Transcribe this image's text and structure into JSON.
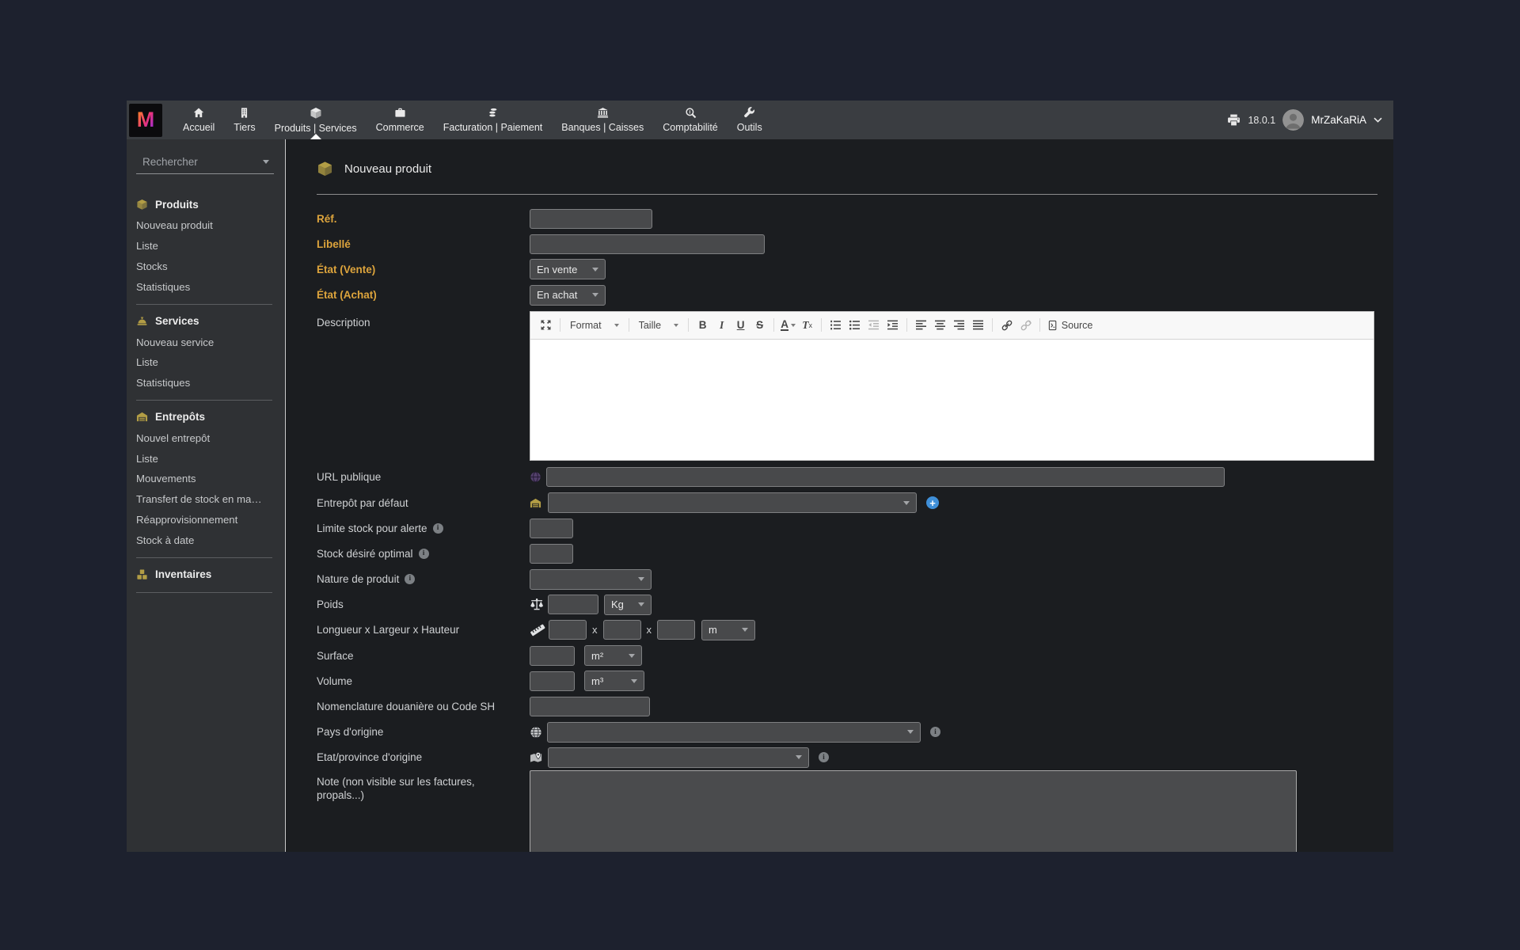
{
  "topbar": {
    "logo_text": "M",
    "menu": {
      "accueil": "Accueil",
      "tiers": "Tiers",
      "produits_services": "Produits | Services",
      "commerce": "Commerce",
      "facturation": "Facturation | Paiement",
      "banques": "Banques | Caisses",
      "comptabilite": "Comptabilité",
      "outils": "Outils"
    },
    "version": "18.0.1",
    "username": "MrZaKaRiA"
  },
  "sidebar": {
    "search_placeholder": "Rechercher",
    "produits": {
      "title": "Produits",
      "items": {
        "nouveau": "Nouveau produit",
        "liste": "Liste",
        "stocks": "Stocks",
        "statistiques": "Statistiques"
      }
    },
    "services": {
      "title": "Services",
      "items": {
        "nouveau": "Nouveau service",
        "liste": "Liste",
        "statistiques": "Statistiques"
      }
    },
    "entrepots": {
      "title": "Entrepôts",
      "items": {
        "nouveau": "Nouvel entrepôt",
        "liste": "Liste",
        "mouvements": "Mouvements",
        "transfert": "Transfert de stock en ma…",
        "reappro": "Réapprovisionnement",
        "stock_a_date": "Stock à date"
      }
    },
    "inventaires": {
      "title": "Inventaires"
    }
  },
  "main": {
    "title": "Nouveau produit",
    "form": {
      "ref_label": "Réf.",
      "libelle_label": "Libellé",
      "etat_vente_label": "État (Vente)",
      "etat_vente_value": "En vente",
      "etat_achat_label": "État (Achat)",
      "etat_achat_value": "En achat",
      "description_label": "Description",
      "url_label": "URL publique",
      "entrepot_label": "Entrepôt par défaut",
      "entrepot_value": "",
      "limite_label": "Limite stock pour alerte",
      "optimal_label": "Stock désiré optimal",
      "nature_label": "Nature de produit",
      "nature_value": "",
      "poids_label": "Poids",
      "poids_unit": "Kg",
      "dim_label": "Longueur x Largeur x Hauteur",
      "dim_sep": "x",
      "dim_unit": "m",
      "surface_label": "Surface",
      "surface_unit": "m²",
      "volume_label": "Volume",
      "volume_unit": "m³",
      "nomenclature_label": "Nomenclature douanière ou Code SH",
      "pays_label": "Pays d'origine",
      "pays_value": "",
      "province_label": "Etat/province d'origine",
      "province_value": "",
      "note_label": "Note (non visible sur les factures, propals...)",
      "info_glyph": "i",
      "plus_glyph": "+"
    },
    "editor": {
      "format": "Format",
      "taille": "Taille",
      "bold": "B",
      "italic": "I",
      "underline": "U",
      "strike": "S",
      "color": "A",
      "removeformat": "T",
      "removeformat_sub": "x",
      "source": "Source"
    }
  },
  "colors": {
    "required_label": "#dda43c",
    "sidebar_icon_yellow": "#b29d45",
    "add_button_blue": "#3f8fd8",
    "topbar_bg": "#3a3d41",
    "sidebar_bg": "#2f3134",
    "main_bg": "#1b1d20",
    "outer_bg": "#1d212e"
  }
}
